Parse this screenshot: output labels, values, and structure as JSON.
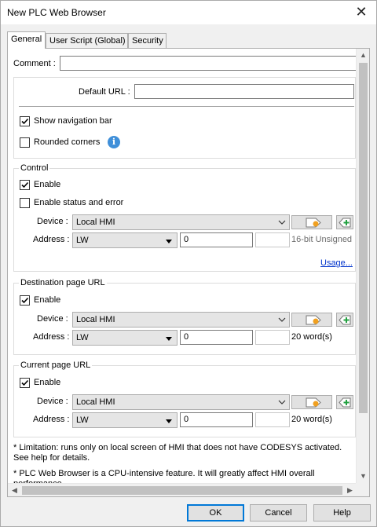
{
  "window": {
    "title": "New PLC Web Browser",
    "close_glyph": "✕"
  },
  "tabs": [
    {
      "label": "General",
      "active": true
    },
    {
      "label": "User Script (Global)"
    },
    {
      "label": "Security"
    }
  ],
  "general": {
    "comment_label": "Comment :",
    "comment_value": "",
    "default_url_label": "Default URL :",
    "default_url_value": "",
    "show_nav_bar": {
      "label": "Show navigation bar",
      "checked": true
    },
    "rounded_corners": {
      "label": "Rounded corners",
      "checked": false
    },
    "info_glyph": "i"
  },
  "control": {
    "title": "Control",
    "enable": {
      "label": "Enable",
      "checked": true
    },
    "enable_status": {
      "label": "Enable status and error",
      "checked": false
    },
    "device_label": "Device :",
    "device_value": "Local HMI",
    "address_label": "Address :",
    "address_type": "LW",
    "address_value": "0",
    "data_type": "16-bit Unsigned",
    "usage_link": "Usage..."
  },
  "destination": {
    "title": "Destination page URL",
    "enable": {
      "label": "Enable",
      "checked": true
    },
    "device_label": "Device :",
    "device_value": "Local HMI",
    "address_label": "Address :",
    "address_type": "LW",
    "address_value": "0",
    "size": "20 word(s)"
  },
  "current": {
    "title": "Current page URL",
    "enable": {
      "label": "Enable",
      "checked": true
    },
    "device_label": "Device :",
    "device_value": "Local HMI",
    "address_label": "Address :",
    "address_type": "LW",
    "address_value": "0",
    "size": "20 word(s)"
  },
  "notes": {
    "limitation": "* Limitation: runs only on local screen of HMI that does not have CODESYS activated. See help for details.",
    "cpu": "* PLC Web Browser is a CPU-intensive feature. It will greatly affect HMI overall performance."
  },
  "buttons": {
    "ok": "OK",
    "cancel": "Cancel",
    "help": "Help"
  },
  "icons": {
    "tag_button": "tag-icon",
    "add_button": "add-tag-icon",
    "info": "info-icon"
  }
}
